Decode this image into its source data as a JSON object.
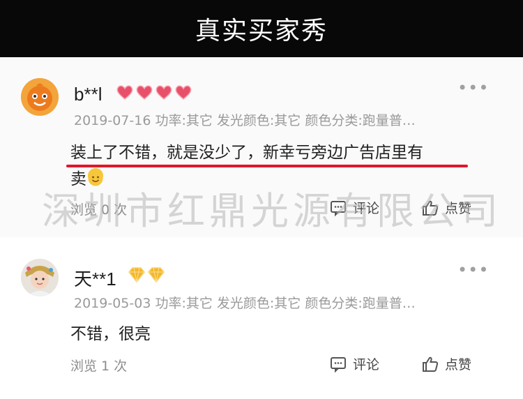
{
  "banner": {
    "title": "真实买家秀"
  },
  "watermark": "深圳市红鼎光源有限公司",
  "reviews": [
    {
      "username": "b**l",
      "badges": [
        "heart-badge-icon",
        "heart-badge-icon",
        "heart-badge-icon",
        "heart-badge-icon"
      ],
      "meta": "2019-07-16 功率:其它 发光颜色:其它 颜色分类:跑量普…",
      "comment_line1": "装上了不错，就是没少了，新幸亏旁边广告店里有",
      "comment_line2": "卖",
      "views": "浏览 0 次",
      "comment_label": "评论",
      "like_label": "点赞"
    },
    {
      "username": "天**1",
      "badges": [
        "diamond-badge-icon",
        "diamond-badge-icon"
      ],
      "meta": "2019-05-03 功率:其它 发光颜色:其它 颜色分类:跑量普…",
      "comment_line1": "不错，很亮",
      "views": "浏览 1 次",
      "comment_label": "评论",
      "like_label": "点赞"
    }
  ],
  "colors": {
    "banner_bg": "#080808",
    "highlight_underline": "#e0162b",
    "heart_badge": "#e8506a",
    "diamond_badge": "#f4b62a"
  }
}
